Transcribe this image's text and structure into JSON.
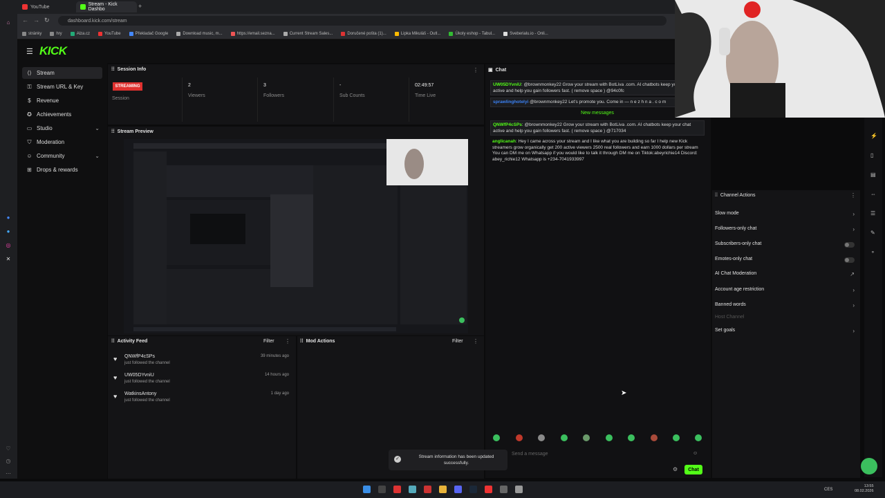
{
  "browser": {
    "tabs": [
      {
        "label": "YouTube",
        "active": false
      },
      {
        "label": "Stream - Kick Dashbo",
        "active": true
      }
    ],
    "url": "dashboard.kick.com/stream",
    "bookmarks": [
      "stránky",
      "hry",
      "Alza.cz",
      "YouTube",
      "Překladač Google",
      "Download music, m...",
      "https://email.sezna...",
      "Current Stream Sales...",
      "Doručené pošta (1)...",
      "Lipka Mikuláš - Outl...",
      "Úkoly eshop - Tabul...",
      "Sveberialu.io - Onli..."
    ]
  },
  "kick": {
    "logo": "KICK",
    "sidebar": [
      {
        "label": "Stream",
        "active": true,
        "expandable": false
      },
      {
        "label": "Stream URL & Key",
        "active": false,
        "expandable": false
      },
      {
        "label": "Revenue",
        "active": false,
        "expandable": false
      },
      {
        "label": "Achievements",
        "active": false,
        "expandable": false
      },
      {
        "label": "Studio",
        "active": false,
        "expandable": true
      },
      {
        "label": "Moderation",
        "active": false,
        "expandable": false
      },
      {
        "label": "Community",
        "active": false,
        "expandable": true
      },
      {
        "label": "Drops & rewards",
        "active": false,
        "expandable": false
      }
    ]
  },
  "session": {
    "title": "Session Info",
    "status": "STREAMING",
    "session_label": "Session",
    "viewers": "2",
    "viewers_label": "Viewers",
    "followers": "3",
    "followers_label": "Followers",
    "subs": "-",
    "subs_label": "Sub Counts",
    "time": "02:49:57",
    "time_label": "Time Live"
  },
  "preview": {
    "title": "Stream Preview"
  },
  "activity": {
    "title": "Activity Feed",
    "filter": "Filter",
    "items": [
      {
        "name": "QNWfP4cSPs",
        "action": "just followed the channel",
        "time": "39 minutes ago"
      },
      {
        "name": "UW05DYvniU",
        "action": "just followed the channel",
        "time": "14 hours ago"
      },
      {
        "name": "WatkinsAntony",
        "action": "just followed the channel",
        "time": "1 day ago"
      }
    ]
  },
  "mod": {
    "title": "Mod Actions",
    "filter": "Filter"
  },
  "chat": {
    "title": "Chat",
    "messages": [
      {
        "user": "UW05DYvniU",
        "text": "@brownmonkey22 Grow your stream with BotLiva .com. AI chatbots keep your chat active and help you gain followers fast. ( remove space ) @94c0fc",
        "color": "#53fc18",
        "boxed": true
      },
      {
        "user": "sprawlinghotelyi",
        "text": "@brownmonkey22 Let's promote you. Come in — n e z h n a . c o m",
        "color": "#3b82f6",
        "boxed": true
      }
    ],
    "new_messages": "New messages",
    "messages2": [
      {
        "user": "QNWfP4cSPs",
        "text": "@brownmonkey22 Grow your stream with BotLiva .com. AI chatbots keep your chat active and help you gain followers fast. ( remove space ) @717034",
        "color": "#53fc18",
        "boxed": true
      },
      {
        "user": "anglicanah",
        "text": "Hey I came across your stream and I like what you are building so far I help new Kick streamers grow organically get 200 active viewers 2500 real followers and earn 1000 dollars per stream You can DM me on Whatsapp if you would like to talk it through DM me on Tiktok:abeyrichie14 Discord: abey_richie12 Whatsapp is +234-7041933997",
        "color": "#53fc18",
        "boxed": false
      }
    ],
    "input_placeholder": "Send a message",
    "send": "Chat"
  },
  "channel_actions": {
    "title": "Channel Actions",
    "items": [
      {
        "label": "Slow mode",
        "kind": "arrow"
      },
      {
        "label": "Followers-only chat",
        "kind": "arrow"
      },
      {
        "label": "Subscribers-only chat",
        "kind": "toggle"
      },
      {
        "label": "Emotes-only chat",
        "kind": "toggle"
      },
      {
        "label": "AI Chat Moderation",
        "kind": "external"
      },
      {
        "label": "Account age restriction",
        "kind": "arrow"
      },
      {
        "label": "Banned words",
        "kind": "arrow"
      },
      {
        "label": "Host Channel",
        "kind": "disabled"
      },
      {
        "label": "Set goals",
        "kind": "arrow"
      }
    ]
  },
  "toast": {
    "text": "Stream information has been updated successfully."
  },
  "taskbar": {
    "lang": "CES",
    "time": "13:55",
    "date": "08.02.2026"
  },
  "colors": {
    "accent": "#53fc18",
    "live": "#e0312f"
  }
}
